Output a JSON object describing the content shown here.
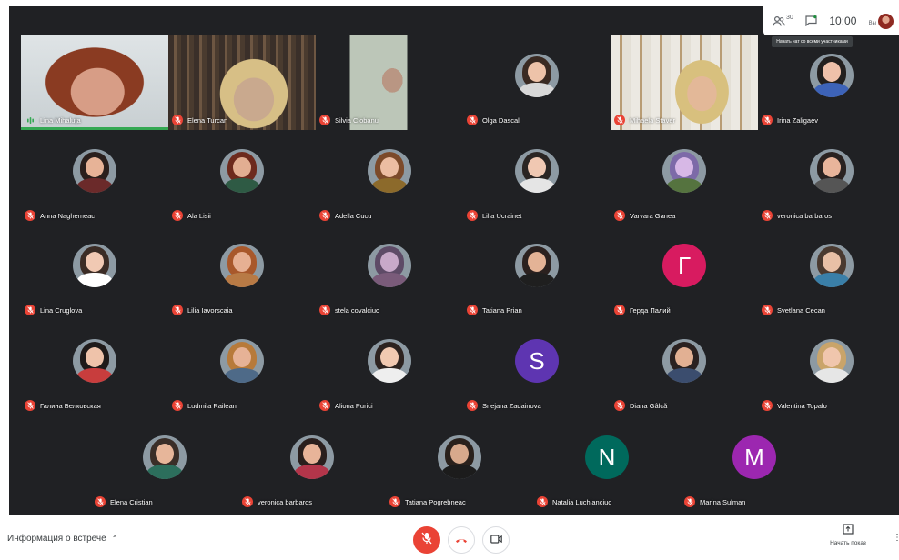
{
  "top_bar": {
    "participant_count": "30",
    "clock": "10:00",
    "me_label": "Вы",
    "chat_tooltip": "Начать чат со всеми участниками"
  },
  "participants": [
    {
      "name": "Lina Mihaluţa",
      "muted": false,
      "speaking": true
    },
    {
      "name": "Elena Turcan",
      "muted": true
    },
    {
      "name": "Silvia Ciobanu",
      "muted": true
    },
    {
      "name": "Olga Dascal",
      "muted": true
    },
    {
      "name": "Mihaela Staver",
      "muted": true
    },
    {
      "name": "Irina Zaligaev",
      "muted": true
    },
    {
      "name": "Anna Naghemeac",
      "muted": true
    },
    {
      "name": "Ala Lisii",
      "muted": true
    },
    {
      "name": "Adella Cucu",
      "muted": true
    },
    {
      "name": "Lilia Ucrainet",
      "muted": true
    },
    {
      "name": "Varvara Ganea",
      "muted": true
    },
    {
      "name": "veronica barbaros",
      "muted": true
    },
    {
      "name": "Lina Cruglova",
      "muted": true
    },
    {
      "name": "Lilia Iavorscaia",
      "muted": true
    },
    {
      "name": "stela covalciuc",
      "muted": true
    },
    {
      "name": "Tatiana Prian",
      "muted": true
    },
    {
      "name": "Герда Палий",
      "muted": true,
      "letter": "Г"
    },
    {
      "name": "Svetlana Cecan",
      "muted": true
    },
    {
      "name": "Галина Белковская",
      "muted": true
    },
    {
      "name": "Ludmila Railean",
      "muted": true
    },
    {
      "name": "Aliona Purici",
      "muted": true
    },
    {
      "name": "Snejana Zadainova",
      "muted": true,
      "letter": "S"
    },
    {
      "name": "Diana Gâlcă",
      "muted": true
    },
    {
      "name": "Valentina Topalo",
      "muted": true
    },
    {
      "name": "Elena Cristian",
      "muted": true
    },
    {
      "name": "veronica barbaros",
      "muted": true
    },
    {
      "name": "Tatiana Pogrebneac",
      "muted": true
    },
    {
      "name": "Natalia Luchianciuc",
      "muted": true,
      "letter": "N"
    },
    {
      "name": "Marina Sulman",
      "muted": true,
      "letter": "M"
    }
  ],
  "bottom_bar": {
    "meeting_info": "Информация о встрече",
    "present_label": "Начать показ"
  },
  "colors": {
    "stage_bg": "#202124",
    "mute_red": "#ea4335",
    "speaking_green": "#34a853",
    "letter_g": "#d81b60",
    "letter_s": "#5e35b1",
    "letter_n": "#00695c",
    "letter_m": "#9c27b0"
  }
}
